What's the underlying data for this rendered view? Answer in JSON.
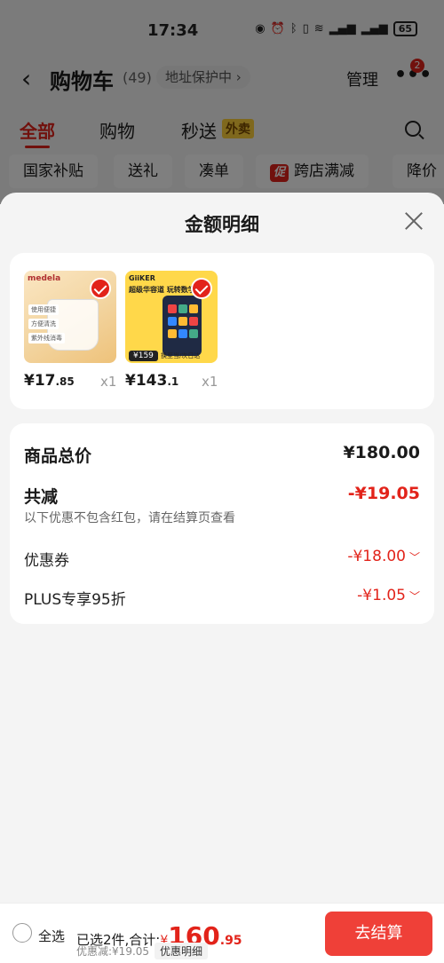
{
  "status": {
    "time": "17:34",
    "battery": "65"
  },
  "nav": {
    "title": "购物车",
    "count": "(49)",
    "address": "地址保护中 ›",
    "manage": "管理",
    "badge": "2"
  },
  "tabs": [
    {
      "label": "全部"
    },
    {
      "label": "购物"
    },
    {
      "label": "秒送"
    }
  ],
  "tab_badge": "外卖",
  "chips": [
    "国家补贴",
    "送礼",
    "凑单",
    "跨店满减",
    "降价"
  ],
  "chip_promo_tag": "促",
  "sheet": {
    "title": "金额明细",
    "goods": [
      {
        "brand": "medela",
        "labels": [
          "使用便捷",
          "方便清洗",
          "紫外线消毒"
        ],
        "price_int": "¥17",
        "price_dec": ".85",
        "qty": "x1"
      },
      {
        "brand": "GiiKER",
        "headline": "超级华容道 玩转数学",
        "tag": "¥159",
        "ship": "换至当/次日达",
        "price_int": "¥143",
        "price_dec": ".1",
        "qty": "x1"
      }
    ],
    "summary": {
      "total_label": "商品总价",
      "total_value": "¥180.00",
      "discount_label": "共减",
      "discount_value": "-¥19.05",
      "note": "以下优惠不包含红包，请在结算页查看",
      "coupon_label": "优惠券",
      "coupon_value": "-¥18.00",
      "plus_label": "PLUS专享95折",
      "plus_value": "-¥1.05"
    }
  },
  "bottom": {
    "select_all": "全选",
    "selected_text": "已选2件,合计:",
    "yen": "¥",
    "total_int": "160",
    "total_dec": ".95",
    "discount_text": "优惠减:¥19.05",
    "detail_btn": "优惠明细",
    "checkout": "去结算"
  },
  "colors": {
    "accent": "#e2231a",
    "checkout_bg": "#ef4038"
  }
}
